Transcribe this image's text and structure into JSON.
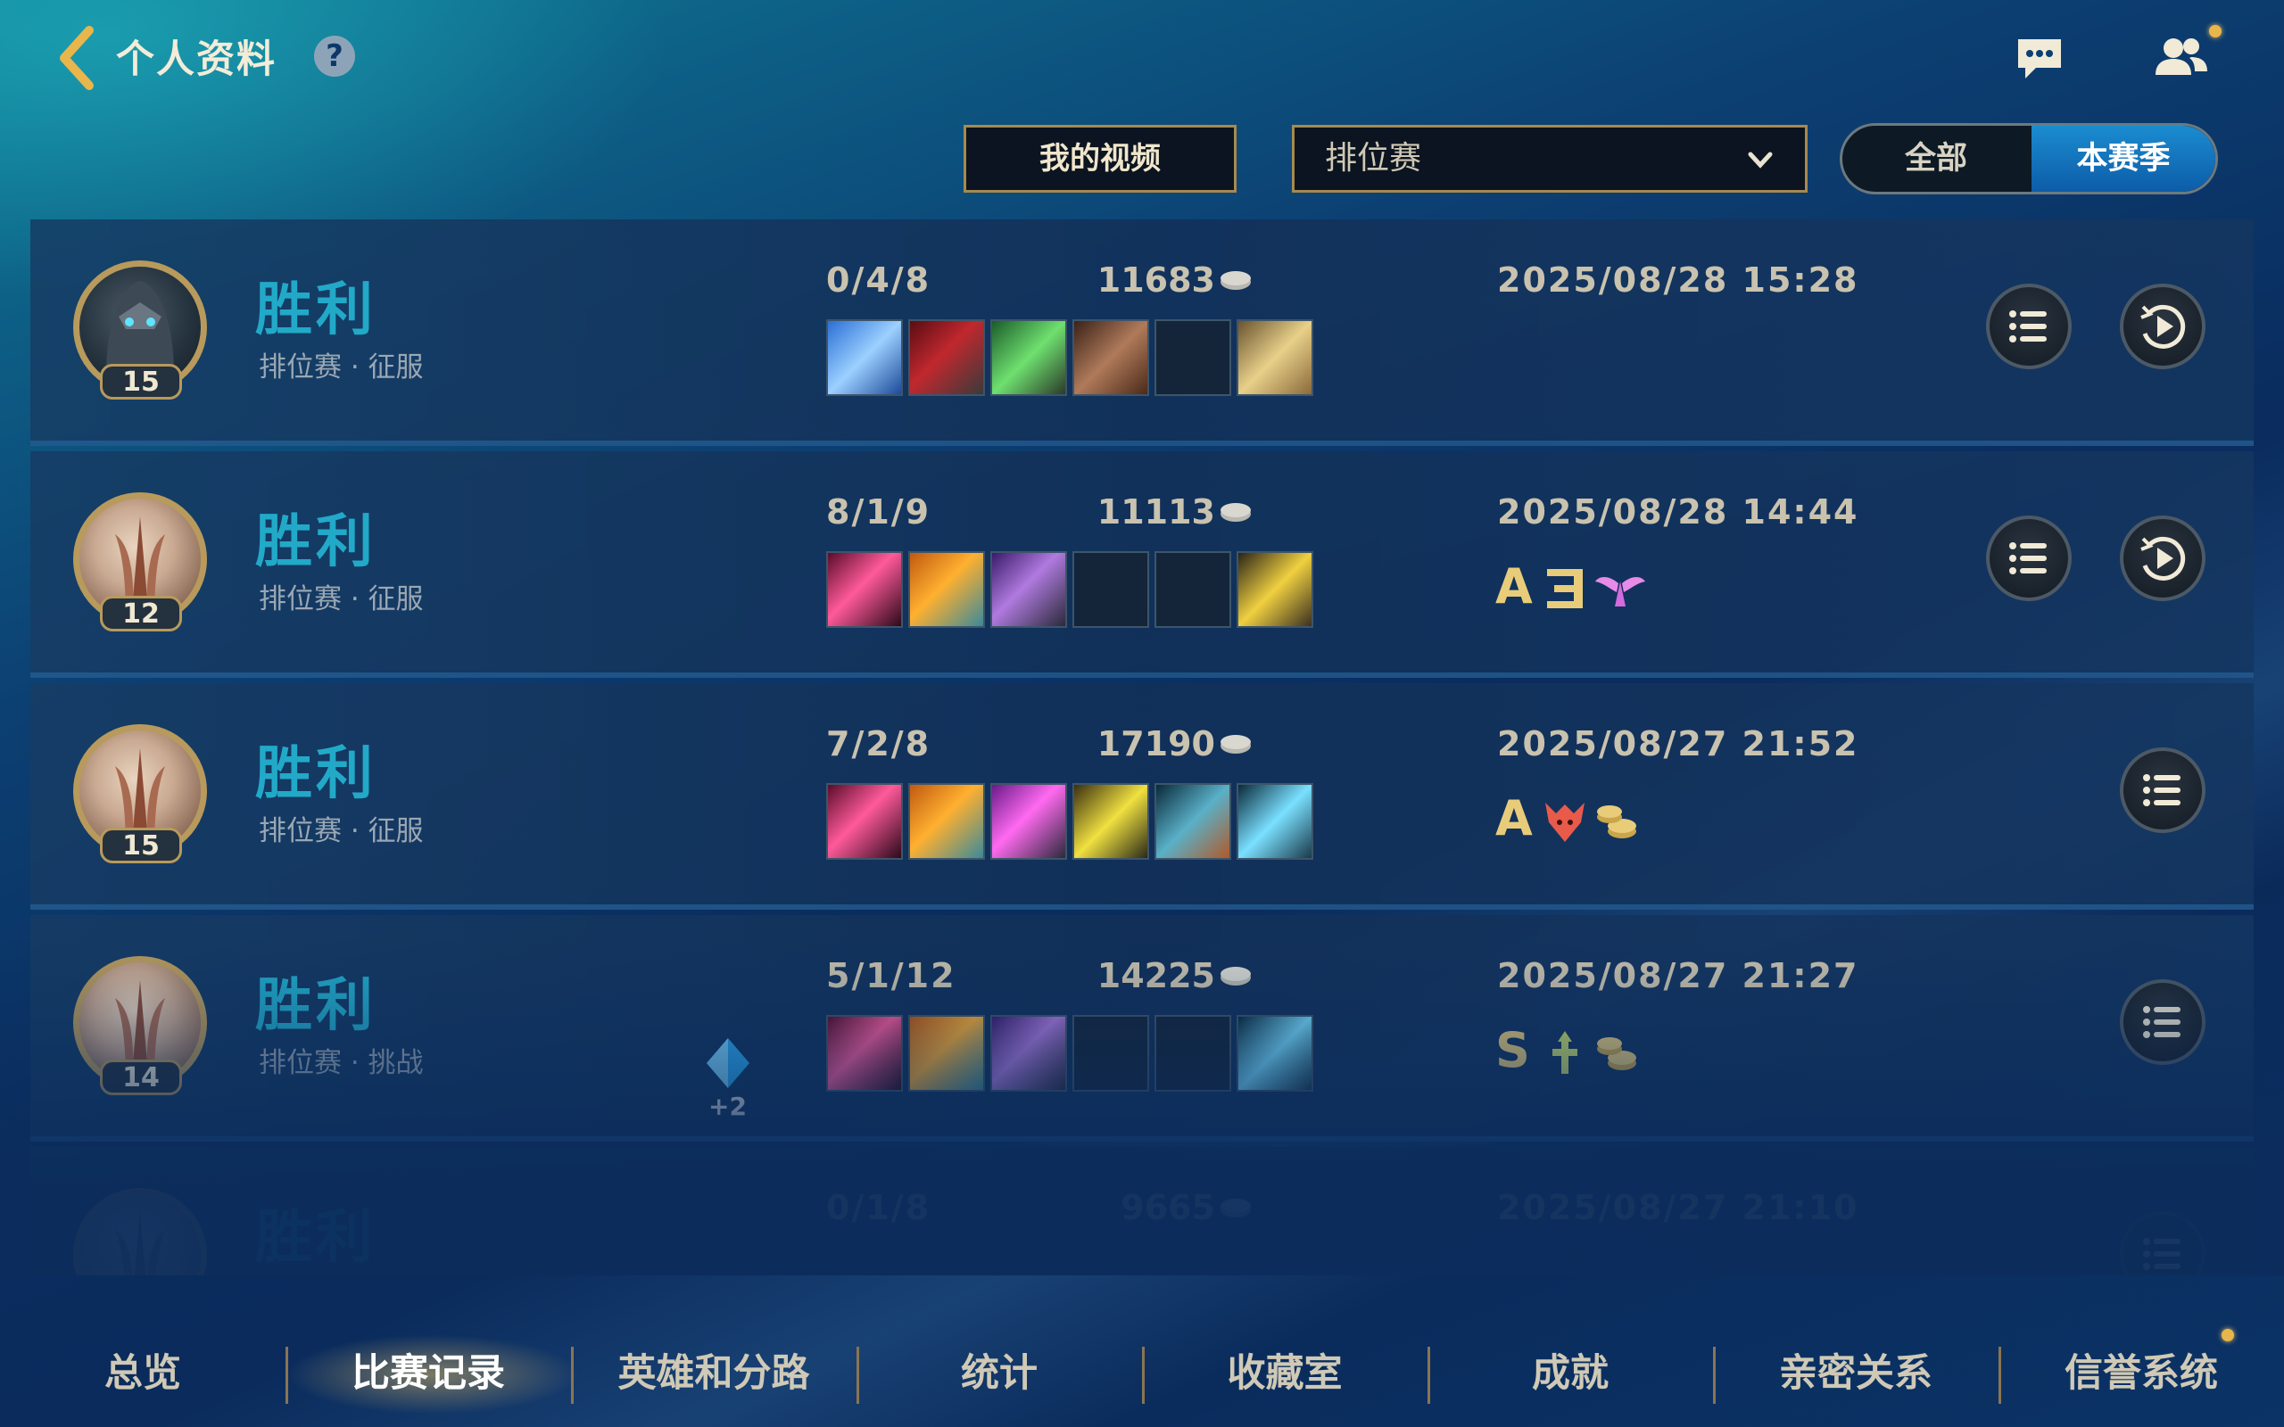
{
  "header": {
    "title": "个人资料",
    "help": "?"
  },
  "filters": {
    "my_video": "我的视频",
    "mode_select": "排位赛",
    "scope_all": "全部",
    "scope_season": "本赛季"
  },
  "matches": [
    {
      "result": "胜利",
      "mode": "排位赛 · 征服",
      "level": "15",
      "kda": "0/4/8",
      "gold": "11683",
      "date": "2025/08/28 15:28",
      "grade": ""
    },
    {
      "result": "胜利",
      "mode": "排位赛 · 征服",
      "level": "12",
      "kda": "8/1/9",
      "gold": "11113",
      "date": "2025/08/28 14:44",
      "grade": "A"
    },
    {
      "result": "胜利",
      "mode": "排位赛 · 征服",
      "level": "15",
      "kda": "7/2/8",
      "gold": "17190",
      "date": "2025/08/27 21:52",
      "grade": "A"
    },
    {
      "result": "胜利",
      "mode": "排位赛 · 挑战",
      "level": "14",
      "kda": "5/1/12",
      "gold": "14225",
      "date": "2025/08/27 21:27",
      "grade": "S",
      "bonus": "+2"
    },
    {
      "result": "胜利",
      "mode": "",
      "level": "",
      "kda": "0/1/8",
      "gold": "9665",
      "date": "2025/08/27 21:10",
      "grade": ""
    }
  ],
  "nav": {
    "tabs": [
      "总览",
      "比赛记录",
      "英雄和分路",
      "统计",
      "收藏室",
      "成就",
      "亲密关系",
      "信誉系统"
    ]
  },
  "colors": {
    "accent_gold": "#a78a4e",
    "win_text": "#22a9c8",
    "season_active": "#1b8cd0"
  }
}
